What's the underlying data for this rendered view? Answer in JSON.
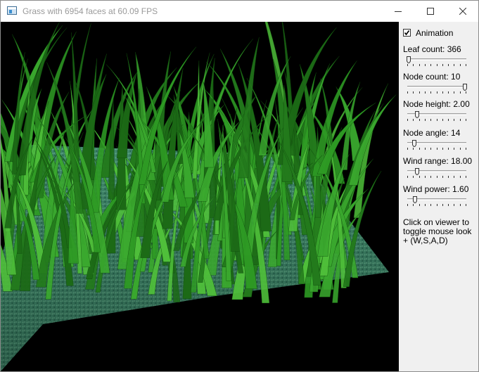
{
  "window": {
    "title": "Grass with 6954 faces at 60.09 FPS",
    "icon": "app-window-icon"
  },
  "controls": {
    "minimize": "minimize-icon",
    "maximize": "maximize-icon",
    "close": "close-icon"
  },
  "panel": {
    "animation": {
      "label": "Animation",
      "checked": true
    },
    "sliders": [
      {
        "label": "Leaf count: 366",
        "fraction": 0.02
      },
      {
        "label": "Node count: 10",
        "fraction": 1.0
      },
      {
        "label": "Node height: 2.00",
        "fraction": 0.17
      },
      {
        "label": "Node angle: 14",
        "fraction": 0.12
      },
      {
        "label": "Wind range: 18.00",
        "fraction": 0.17
      },
      {
        "label": "Wind power: 1.60",
        "fraction": 0.14
      }
    ],
    "help_text": "Click on viewer to toggle mouse look + (W,S,A,D)"
  },
  "colors": {
    "viewport_bg": "#000000",
    "ground": "#3d8a6a",
    "grass_dark": "#1c6a16",
    "grass_mid": "#2e9a24",
    "grass_light": "#4fbf3a"
  }
}
